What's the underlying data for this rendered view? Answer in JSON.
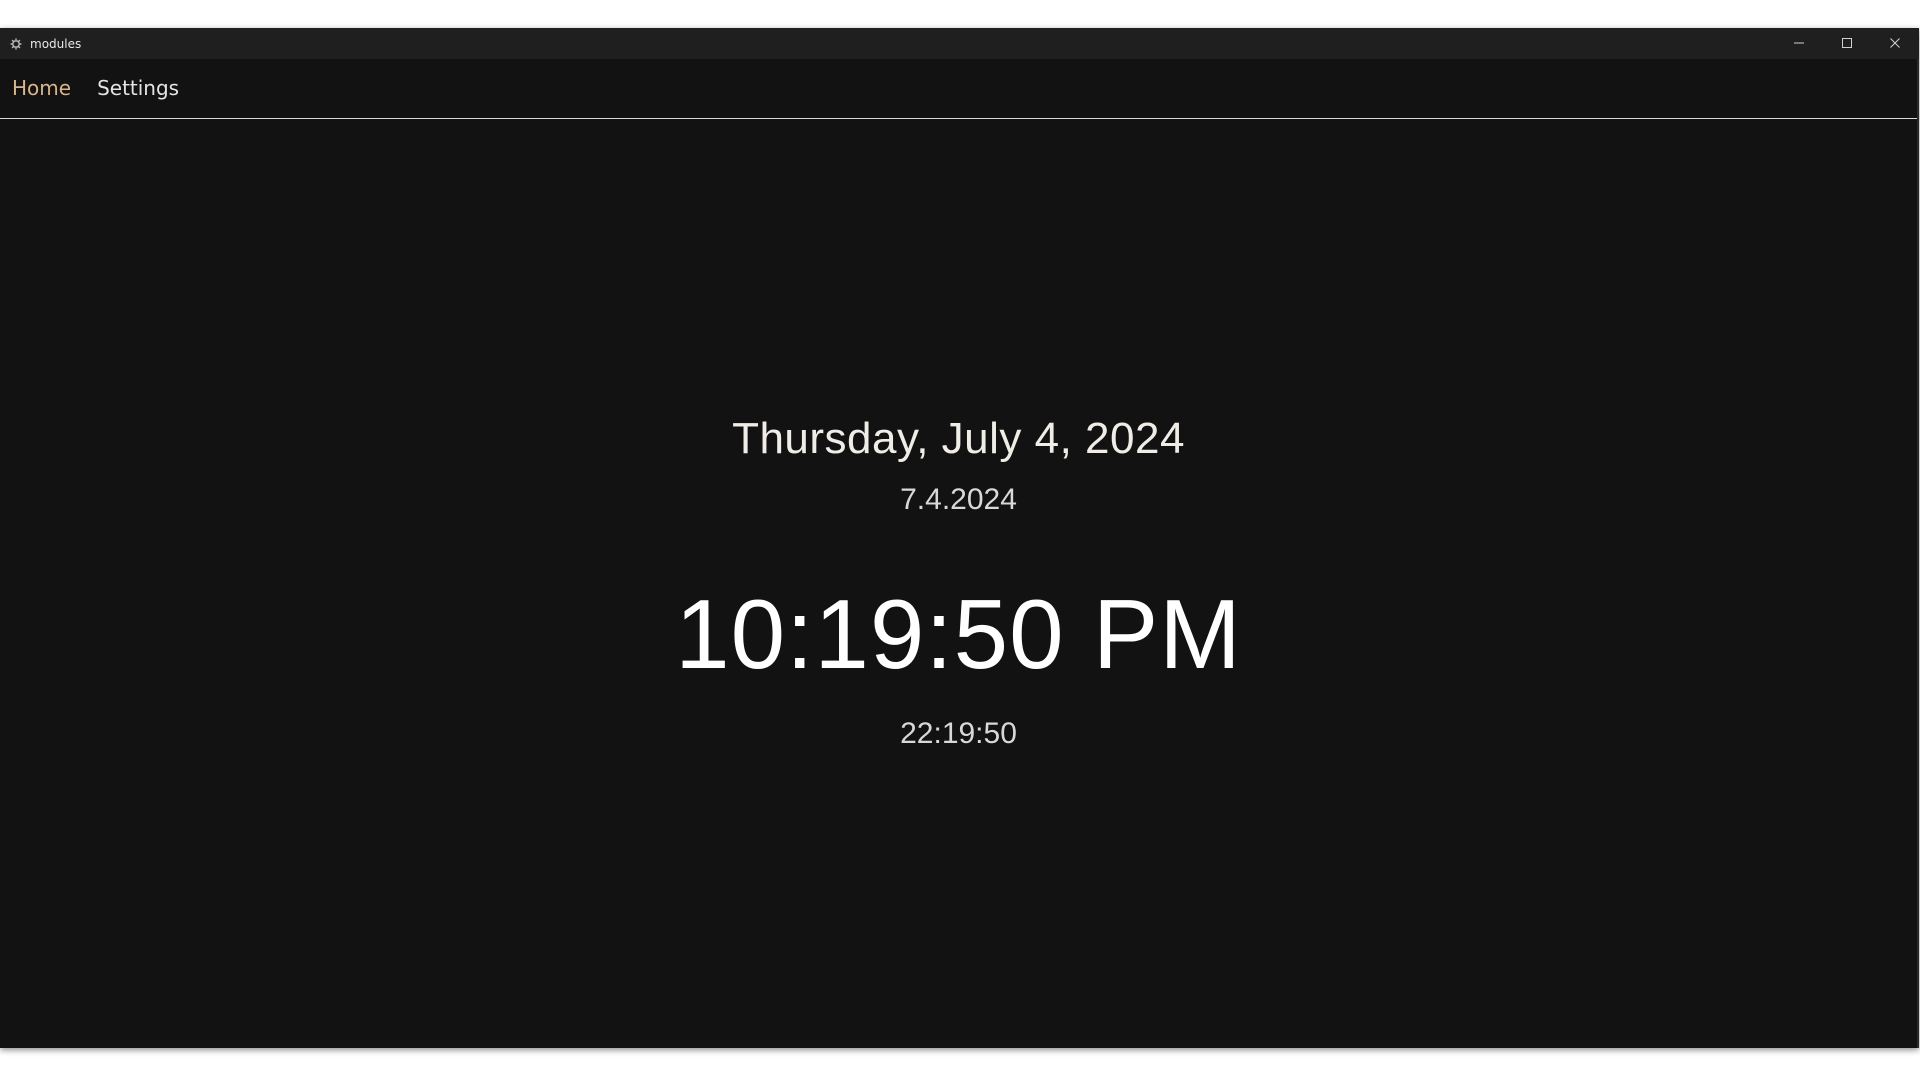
{
  "window": {
    "title": "modules",
    "controls": {
      "minimize_icon": "minimize-icon",
      "maximize_icon": "maximize-icon",
      "close_icon": "close-icon"
    }
  },
  "nav": {
    "items": [
      {
        "label": "Home",
        "active": true
      },
      {
        "label": "Settings",
        "active": false
      }
    ]
  },
  "clock": {
    "long_date": "Thursday, July 4, 2024",
    "short_date": "7.4.2024",
    "time_12h": "10:19:50 PM",
    "time_24h": "22:19:50"
  },
  "colors": {
    "background": "#121212",
    "titlebar": "#1f1f1f",
    "accent": "#d9b58a",
    "text": "#ededed"
  }
}
